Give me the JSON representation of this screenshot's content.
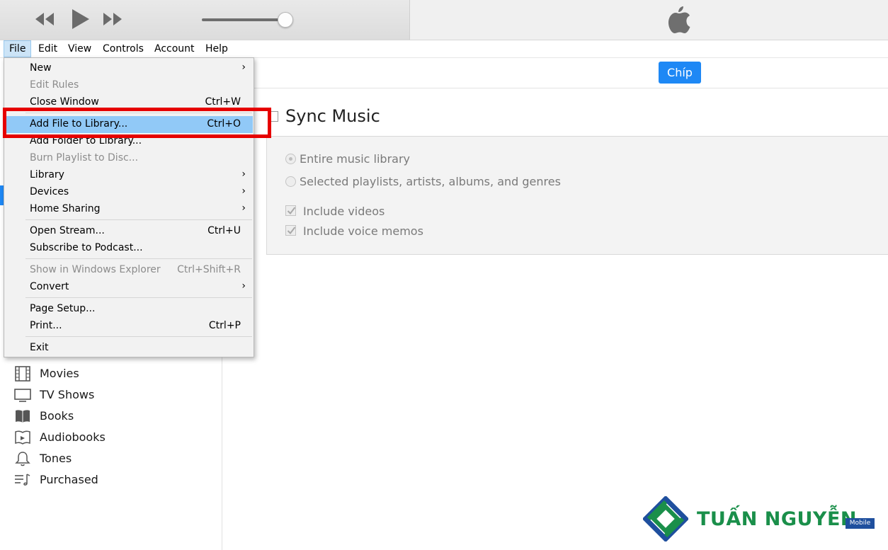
{
  "menubar": [
    "File",
    "Edit",
    "View",
    "Controls",
    "Account",
    "Help"
  ],
  "header": {
    "chip_label": "Chíp"
  },
  "sync": {
    "title": "Sync Music",
    "option_entire": "Entire music library",
    "option_selected": "Selected playlists, artists, albums, and genres",
    "include_videos": "Include videos",
    "include_voice_memos": "Include voice memos"
  },
  "file_menu": {
    "new": "New",
    "edit_rules": "Edit Rules",
    "close_window": "Close Window",
    "close_window_key": "Ctrl+W",
    "add_file": "Add File to Library...",
    "add_file_key": "Ctrl+O",
    "add_folder": "Add Folder to Library...",
    "burn_playlist": "Burn Playlist to Disc...",
    "library": "Library",
    "devices": "Devices",
    "home_sharing": "Home Sharing",
    "open_stream": "Open Stream...",
    "open_stream_key": "Ctrl+U",
    "subscribe_podcast": "Subscribe to Podcast...",
    "show_explorer": "Show in Windows Explorer",
    "show_explorer_key": "Ctrl+Shift+R",
    "convert": "Convert",
    "page_setup": "Page Setup...",
    "print": "Print...",
    "print_key": "Ctrl+P",
    "exit": "Exit",
    "submenu_arrow": "›"
  },
  "sidebar": {
    "items": [
      {
        "label": "Movies",
        "icon": "film-icon"
      },
      {
        "label": "TV Shows",
        "icon": "tv-icon"
      },
      {
        "label": "Books",
        "icon": "book-icon"
      },
      {
        "label": "Audiobooks",
        "icon": "audiobook-icon"
      },
      {
        "label": "Tones",
        "icon": "bell-icon"
      },
      {
        "label": "Purchased",
        "icon": "purchased-list-icon"
      }
    ]
  },
  "watermark": {
    "brand": "TUẤN NGUYỄN",
    "badge": "Mobile"
  },
  "colors": {
    "accent": "#1e88f5",
    "highlight": "#91c9f7",
    "annotation": "#e60000",
    "brand_green": "#1a8f4a",
    "brand_blue": "#1f4f9e"
  }
}
